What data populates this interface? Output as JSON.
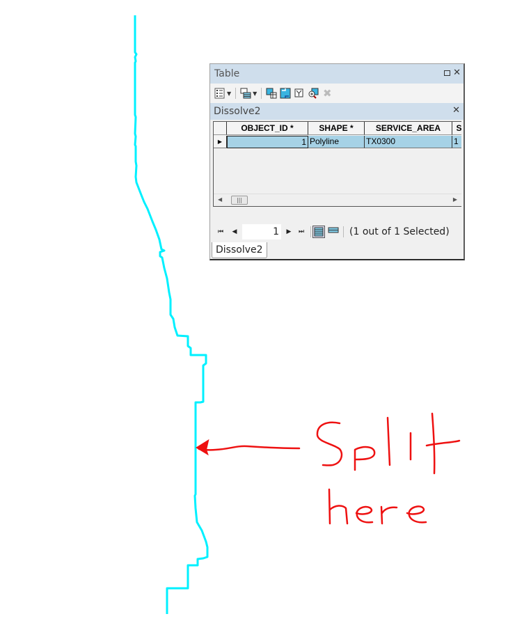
{
  "table_window": {
    "title": "Table",
    "title_buttons": [
      "restore-icon",
      "close-icon"
    ],
    "toolbar": {
      "icons": [
        "table-options-icon",
        "related-tables-icon",
        "select-by-attributes-icon",
        "switch-selection-icon",
        "clear-selection-icon",
        "zoom-to-selected-icon",
        "delete-selected-icon"
      ]
    },
    "layer_tab_title": "Dissolve2",
    "grid": {
      "columns": [
        "OBJECT_ID *",
        "SHAPE *",
        "SERVICE_AREA",
        "S"
      ],
      "rows": [
        [
          "1",
          "Polyline",
          "TX0300",
          "1"
        ]
      ]
    },
    "navigator": {
      "current_record": "1",
      "status": "(1 out of 1 Selected)"
    },
    "bottom_tab": "Dissolve2"
  },
  "annotation": {
    "line1": "Split",
    "line2": "here",
    "color": "#ee1111"
  },
  "map": {
    "feature_color": "#00f0ff"
  }
}
